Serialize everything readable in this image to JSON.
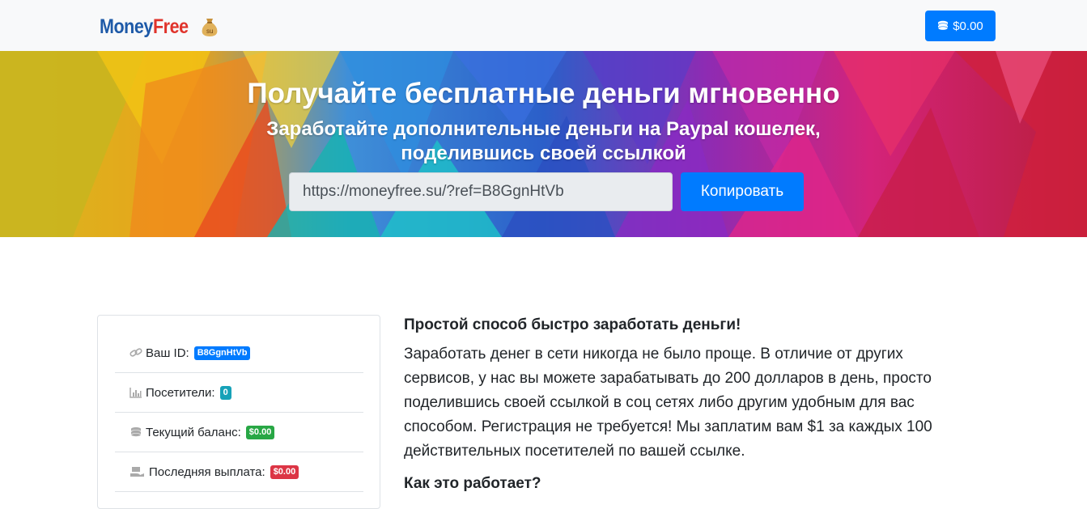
{
  "navbar": {
    "brand_part1": "Money",
    "brand_part2": "Free",
    "brand_icon": "money-bag-icon",
    "balance_label": "$0.00",
    "balance_icon": "coins-icon"
  },
  "hero": {
    "title": "Получайте бесплатные деньги мгновенно",
    "subtitle_line1": "Заработайте дополнительные деньги на Paypal кошелек,",
    "subtitle_line2": "поделившись своей ссылкой",
    "ref_link": "https://moneyfree.su/?ref=B8GgnHtVb",
    "copy_label": "Копировать"
  },
  "stats": {
    "items": [
      {
        "label": "Ваш ID:",
        "value": "B8GgnHtVb",
        "icon": "link-icon",
        "color": "#007bff"
      },
      {
        "label": "Посетители:",
        "value": "0",
        "icon": "chart-icon",
        "color": "#17a2b8"
      },
      {
        "label": "Текущий баланс:",
        "value": "$0.00",
        "icon": "coins-icon",
        "color": "#28a745"
      },
      {
        "label": "Последняя выплата:",
        "value": "$0.00",
        "icon": "money-hand-icon",
        "color": "#dc3545"
      }
    ]
  },
  "article": {
    "heading": "Простой способ быстро заработать деньги!",
    "paragraph": "Заработать денег в сети никогда не было проще. В отличие от других сервисов, у нас вы можете зарабатывать до 200 долларов в день, просто поделившись своей ссылкой в соц сетях либо другим удобным для вас способом. Регистрация не требуется! Мы заплатим вам $1 за каждых 100 действительных посетителей по вашей ссылке.",
    "subheading": "Как это работает?"
  },
  "colors": {
    "primary": "#007bff",
    "brand_blue": "#1e5aa8",
    "brand_red": "#e0332b"
  }
}
